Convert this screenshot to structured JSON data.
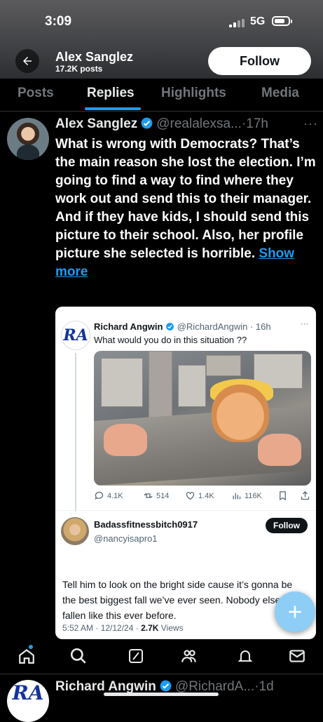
{
  "status_bar": {
    "time": "3:09",
    "network": "5G"
  },
  "header": {
    "profile_name": "Alex Sanglez",
    "posts_count": "17.2K posts",
    "follow_label": "Follow",
    "back_icon": "arrow-left-icon"
  },
  "tabs": [
    {
      "label": "Posts",
      "active": false
    },
    {
      "label": "Replies",
      "active": true
    },
    {
      "label": "Highlights",
      "active": false
    },
    {
      "label": "Media",
      "active": false
    }
  ],
  "post": {
    "author": "Alex Sanglez",
    "handle": "@realalexsa...",
    "time": "·17h",
    "body": "What is wrong with Democrats? That’s the main reason she lost the election. I’m going to find a way to find where they work out and send this to their manager. And if they have kids, I should send this picture to their school. Also, her profile picture she selected is horrible.",
    "show_more": "Show more"
  },
  "embedded": {
    "logo_text": "RA",
    "author": "Richard Angwin",
    "handle": "@RichardAngwin · 16h",
    "text": "What would you do in this situation ??",
    "actions": {
      "replies": "4.1K",
      "reposts": "514",
      "likes": "1.4K",
      "views": "116K"
    },
    "reply": {
      "name": "Badassfitnessbitch0917",
      "handle": "@nancyisapro1",
      "follow_label": "Follow",
      "text": "Tell him to look on the bright side cause it’s gonna be the best biggest fall we’ve ever seen. Nobody else has fallen like this ever before.",
      "meta": "5:52 AM · 12/12/24 · ",
      "views_count": "2.7K",
      "views_label": " Views"
    }
  },
  "next_post": {
    "author": "Richard Angwin",
    "handle": "@RichardA...",
    "time": "·1d"
  },
  "colors": {
    "accent": "#1d9bf0",
    "background": "#000000",
    "text": "#e7e9ea",
    "muted": "#71767b"
  }
}
